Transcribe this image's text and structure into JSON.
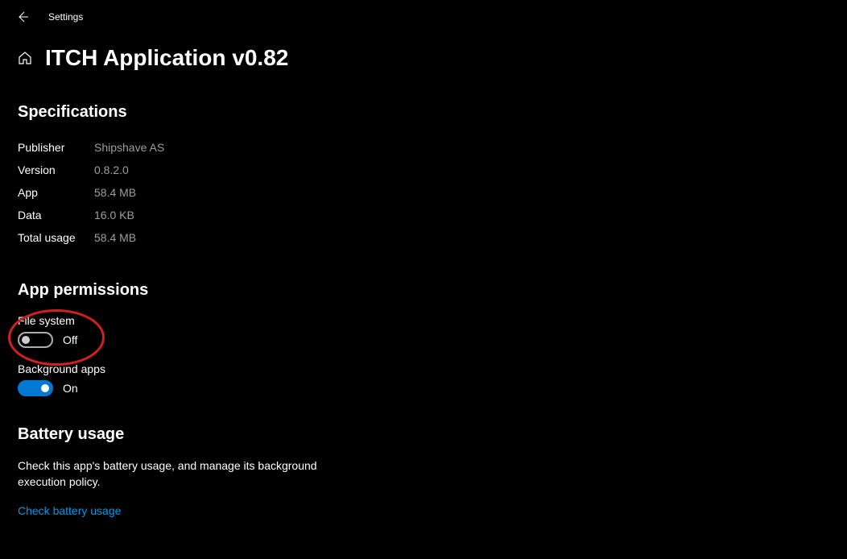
{
  "header": {
    "title": "Settings"
  },
  "page": {
    "title": "ITCH Application v0.82"
  },
  "specifications": {
    "heading": "Specifications",
    "rows": [
      {
        "label": "Publisher",
        "value": "Shipshave AS"
      },
      {
        "label": "Version",
        "value": "0.8.2.0"
      },
      {
        "label": "App",
        "value": "58.4 MB"
      },
      {
        "label": "Data",
        "value": "16.0 KB"
      },
      {
        "label": "Total usage",
        "value": "58.4 MB"
      }
    ]
  },
  "permissions": {
    "heading": "App permissions",
    "file_system": {
      "label": "File system",
      "status": "Off"
    },
    "background_apps": {
      "label": "Background apps",
      "status": "On"
    }
  },
  "battery": {
    "heading": "Battery usage",
    "description": "Check this app's battery usage, and manage its background execution policy.",
    "link_text": "Check battery usage"
  }
}
